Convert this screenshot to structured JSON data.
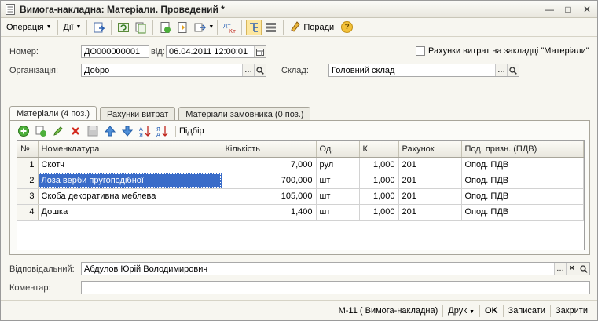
{
  "window": {
    "title": "Вимога-накладна: Матеріали. Проведений *",
    "minimize": "—",
    "maximize": "□",
    "close": "✕"
  },
  "toolbar": {
    "operation_label": "Операція",
    "actions_label": "Дії",
    "tips_label": "Поради",
    "help_label": "?"
  },
  "form": {
    "number_label": "Номер:",
    "number_value": "ДО000000001",
    "from_label": "від:",
    "date_value": "06.04.2011 12:00:01",
    "costs_checkbox_label": "Рахунки витрат на закладці \"Матеріали\"",
    "org_label": "Організація:",
    "org_value": "Добро",
    "warehouse_label": "Склад:",
    "warehouse_value": "Головний склад",
    "responsible_label": "Відповідальний:",
    "responsible_value": "Абдулов Юрій Володимирович",
    "comment_label": "Коментар:",
    "comment_value": ""
  },
  "tabs": [
    {
      "label": "Матеріали (4 поз.)"
    },
    {
      "label": "Рахунки витрат"
    },
    {
      "label": "Матеріали замовника (0 поз.)"
    }
  ],
  "grid_toolbar": {
    "selection_label": "Підбір"
  },
  "table": {
    "columns": [
      "№",
      "Номенклатура",
      "Кількість",
      "Од.",
      "К.",
      "Рахунок",
      "Под. призн. (ПДВ)"
    ],
    "rows": [
      {
        "n": "1",
        "name": "Скотч",
        "qty": "7,000",
        "unit": "рул",
        "k": "1,000",
        "account": "201",
        "tax": "Опод. ПДВ"
      },
      {
        "n": "2",
        "name": "Лоза верби пругоподібної",
        "qty": "700,000",
        "unit": "шт",
        "k": "1,000",
        "account": "201",
        "tax": "Опод. ПДВ"
      },
      {
        "n": "3",
        "name": "Скоба декоративна меблева",
        "qty": "105,000",
        "unit": "шт",
        "k": "1,000",
        "account": "201",
        "tax": "Опод. ПДВ"
      },
      {
        "n": "4",
        "name": "Дошка",
        "qty": "1,400",
        "unit": "шт",
        "k": "1,000",
        "account": "201",
        "tax": "Опод. ПДВ"
      }
    ]
  },
  "bottombar": {
    "form_name": "М-11 ( Вимога-накладна)",
    "print_label": "Друк",
    "ok_label": "OK",
    "save_label": "Записати",
    "close_label": "Закрити"
  },
  "colors": {
    "selection": "#3a6cc9",
    "accent": "#f3c13a"
  }
}
